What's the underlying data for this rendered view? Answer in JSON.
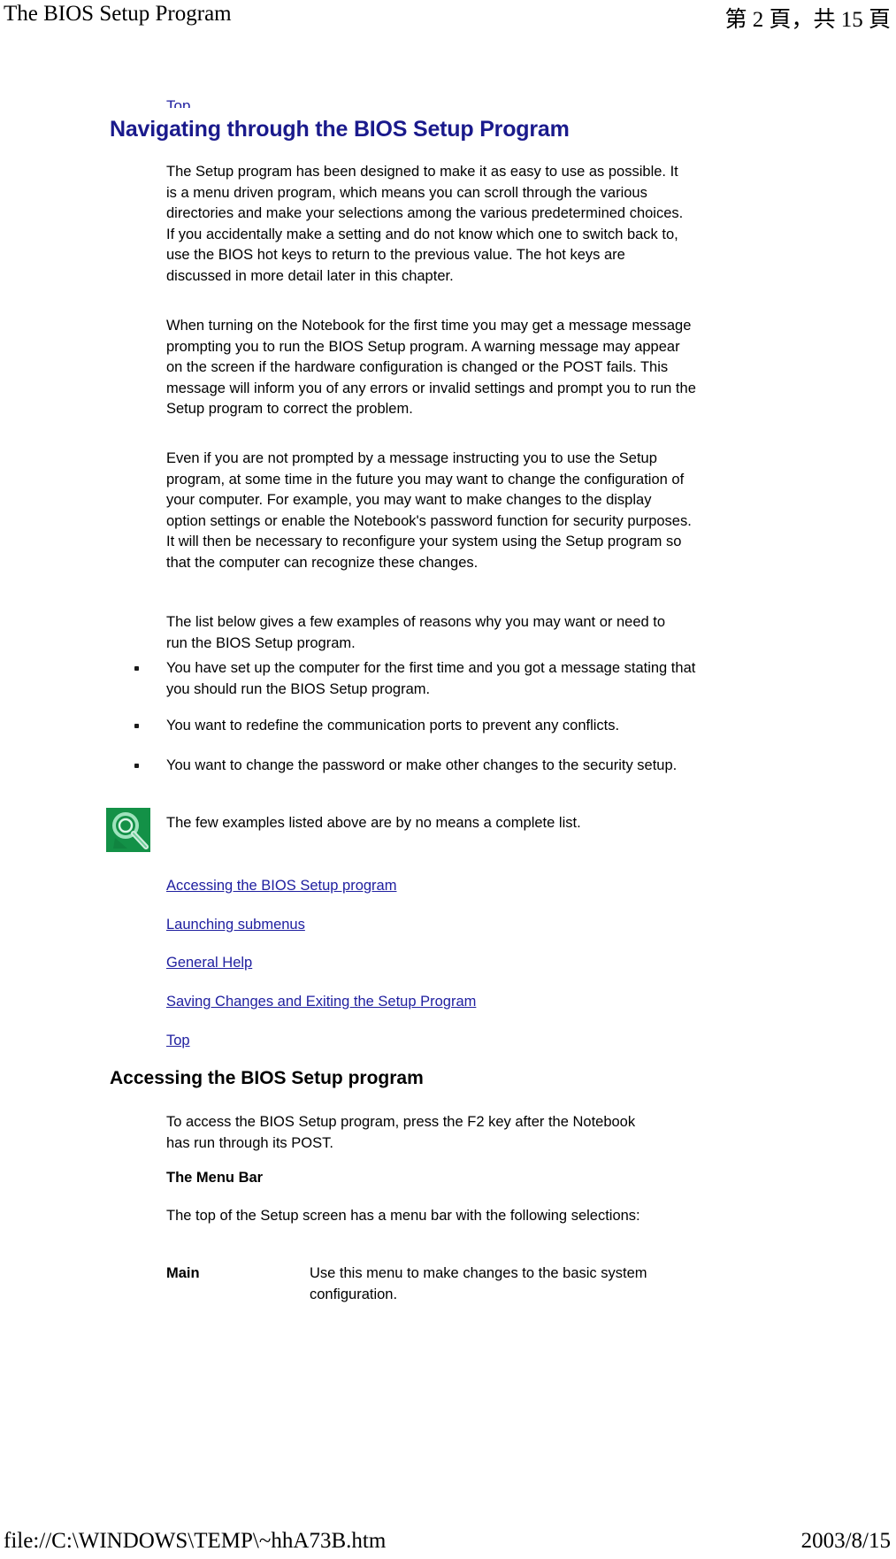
{
  "header": {
    "left": "The BIOS Setup Program",
    "right": "第 2 頁，共 15 頁"
  },
  "footer": {
    "left": "file://C:\\WINDOWS\\TEMP\\~hhA73B.htm",
    "right": "2003/8/15"
  },
  "colors": {
    "heading_blue": "#1a1a8c",
    "link_blue": "#2020a0",
    "note_icon_green": "#139147",
    "text_black": "#000000"
  },
  "content": {
    "top_link_clipped": "Top",
    "section_title": "Navigating through the BIOS Setup Program",
    "paragraphs": [
      "The Setup program has been designed to make it as easy to use as possible. It is a menu driven program, which means you can scroll through the various directories and make your selections among the various predetermined choices. If you accidentally make a setting and do not know which one to switch back to, use the BIOS hot keys to return to the previous value. The hot keys are discussed in more detail later in this chapter.",
      "When turning on the Notebook for the first time you may get a message message prompting you to run the BIOS Setup program. A warning message may appear on the screen if the hardware configuration is changed or the POST fails. This message will inform you of any errors or invalid settings and prompt you to run the Setup program to correct the problem.",
      "Even if you are not prompted by a message instructing you to use the Setup program, at some time in the future you may want to change the configuration of your computer. For example, you may want to make changes to the display option settings or enable the Notebook's password function for security purposes. It will then be necessary to reconfigure your system using the Setup program so that the computer can recognize these changes.",
      "The list below gives a few examples of reasons why you may want or need to run the BIOS Setup program."
    ],
    "bullets": [
      "You have set up the computer for the first time and you got a message stating that you should run the BIOS Setup program.",
      "You want to redefine the communication ports to prevent any conflicts.",
      "You want to change the password or make other changes to the security setup."
    ],
    "note": {
      "icon": "note-magnifier-icon",
      "text": "The few examples listed above are by no means a complete list."
    },
    "toc_links": [
      "Accessing the BIOS Setup program",
      "Launching submenus",
      "General Help",
      "Saving Changes and Exiting the Setup Program",
      "Top"
    ],
    "subsection_title": "Accessing the BIOS Setup program",
    "access_paragraph": "To access the BIOS Setup program, press the F2 key after the Notebook has run through its POST.",
    "menu_bar_heading": "The Menu Bar",
    "menu_bar_paragraph": "The top of the Setup screen has a menu bar with the following selections:",
    "menu_entries": [
      {
        "term": "Main",
        "description": "Use this menu to make changes to the basic system configuration."
      }
    ]
  }
}
